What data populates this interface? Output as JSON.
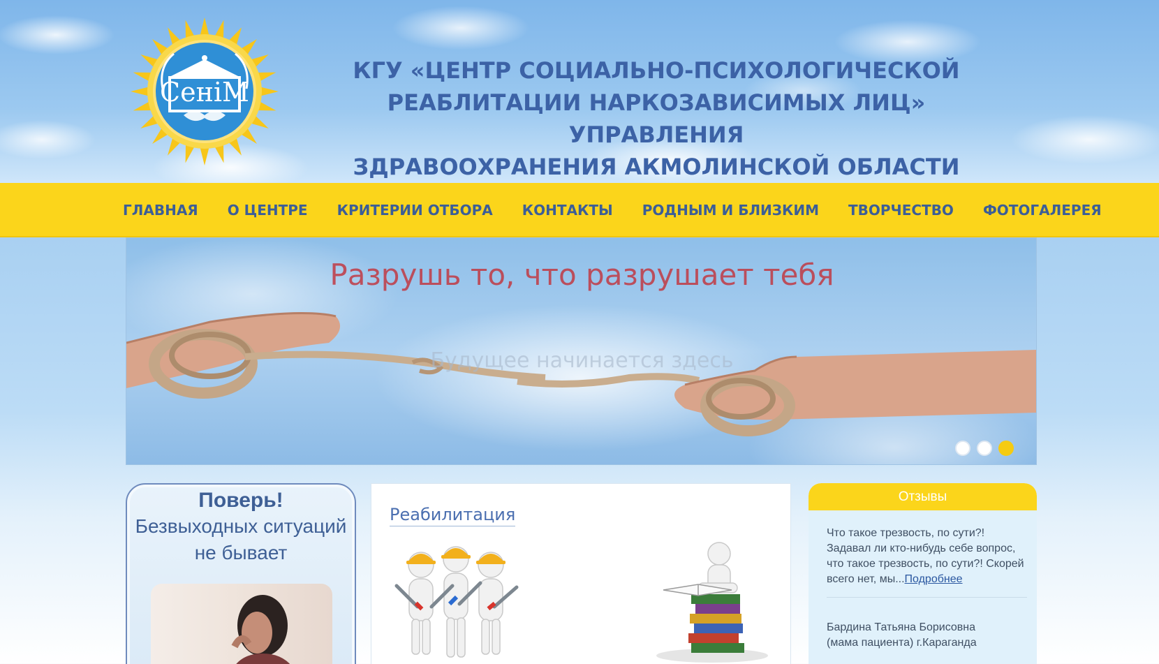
{
  "header": {
    "title_line1": "КГУ «ЦЕНТР СОЦИАЛЬНО-ПСИХОЛОГИЧЕСКОЙ",
    "title_line2": "РЕАБЛИТАЦИИ НАРКОЗАВИСИМЫХ ЛИЦ» УПРАВЛЕНИЯ",
    "title_line3": "ЗДРАВООХРАНЕНИЯ АКМОЛИНСКОЙ ОБЛАСТИ",
    "logo_text": "СеніМ"
  },
  "nav": {
    "items": [
      {
        "label": "ГЛАВНАЯ"
      },
      {
        "label": "О ЦЕНТРЕ"
      },
      {
        "label": "КРИТЕРИИ ОТБОРА"
      },
      {
        "label": "КОНТАКТЫ"
      },
      {
        "label": "РОДНЫМ И БЛИЗКИМ"
      },
      {
        "label": "ТВОРЧЕСТВО"
      },
      {
        "label": "ФОТОГАЛЕРЕЯ"
      }
    ]
  },
  "slider": {
    "caption": "Разрушь то, что разрушает тебя",
    "subcaption": "Будущее начинается здесь",
    "slide_count": 3,
    "active_slide": 3
  },
  "promo": {
    "heading": "Поверь!",
    "line1": "Безвыходных ситуаций",
    "line2": "не бывает"
  },
  "content": {
    "title": "Реабилитация"
  },
  "reviews": {
    "heading": "Отзывы",
    "review_text": "Что такое трезвость, по сути?! Задавал ли кто-нибудь себе вопрос, что такое трезвость, по сути?! Скорей всего нет, мы...",
    "more_link": "Подробнее",
    "reviewer_line1": "Бардина Татьяна Борисовна",
    "reviewer_line2": "(мама пациента) г.Караганда"
  },
  "colors": {
    "nav_bg": "#fbd51b",
    "title_blue": "#3c62a6",
    "slide_caption": "#c13a44",
    "active_dot": "#f5cb12"
  }
}
